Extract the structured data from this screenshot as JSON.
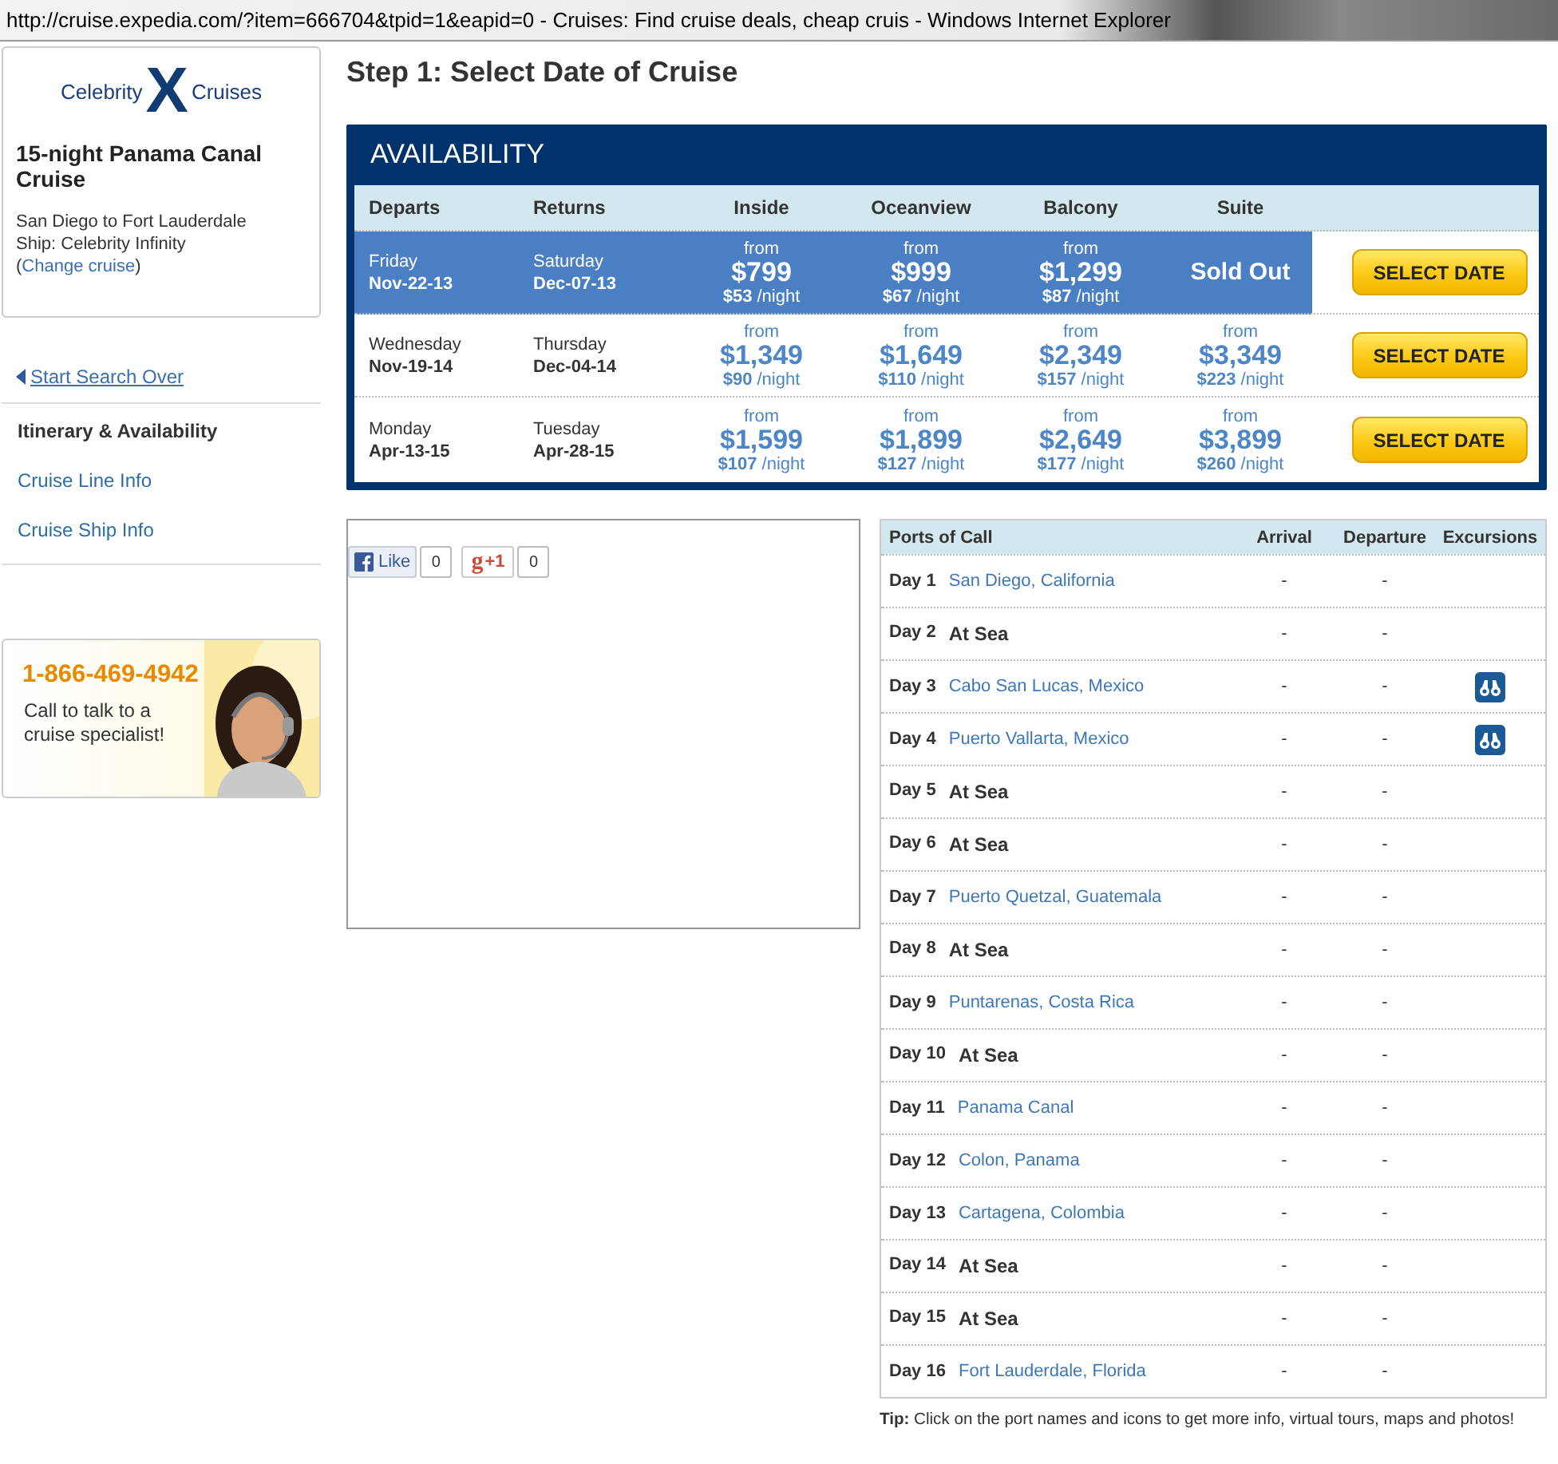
{
  "window": {
    "title": "http://cruise.expedia.com/?item=666704&tpid=1&eapid=0 - Cruises: Find cruise deals, cheap cruis - Windows Internet Explorer"
  },
  "sidebar": {
    "logo": {
      "left": "Celebrity",
      "mark": "X",
      "right": "Cruises"
    },
    "cruise_title": "15-night Panama Canal Cruise",
    "route": "San Diego to Fort Lauderdale",
    "ship": "Ship:  Celebrity Infinity",
    "change_open": "(",
    "change_link": "Change cruise",
    "change_close": ")",
    "start_over": "Start Search Over",
    "nav": [
      {
        "label": "Itinerary & Availability",
        "selected": true
      },
      {
        "label": "Cruise Line Info",
        "selected": false
      },
      {
        "label": "Cruise Ship Info",
        "selected": false
      }
    ],
    "ad": {
      "phone": "1-866-469-4942",
      "text": "Call to talk to a cruise specialist!"
    }
  },
  "heading": "Step 1: Select Date of Cruise",
  "availability": {
    "title": "AVAILABILITY",
    "columns": [
      "Departs",
      "Returns",
      "Inside",
      "Oceanview",
      "Balcony",
      "Suite"
    ],
    "rows": [
      {
        "selected": true,
        "depart_day": "Friday",
        "depart_date": "Nov-22-13",
        "return_day": "Saturday",
        "return_date": "Dec-07-13",
        "prices": [
          {
            "kind": "price",
            "from": "from",
            "price": "$799",
            "per_night": "**$53** /night"
          },
          {
            "kind": "price",
            "from": "from",
            "price": "$999",
            "per_night": "**$67** /night"
          },
          {
            "kind": "price",
            "from": "from",
            "price": "$1,299",
            "per_night": "**$87** /night"
          },
          {
            "kind": "sold_out",
            "text": "Sold Out"
          }
        ],
        "button": "SELECT DATE"
      },
      {
        "selected": false,
        "depart_day": "Wednesday",
        "depart_date": "Nov-19-14",
        "return_day": "Thursday",
        "return_date": "Dec-04-14",
        "prices": [
          {
            "kind": "price",
            "from": "from",
            "price": "$1,349",
            "per_night": "**$90** /night"
          },
          {
            "kind": "price",
            "from": "from",
            "price": "$1,649",
            "per_night": "**$110** /night"
          },
          {
            "kind": "price",
            "from": "from",
            "price": "$2,349",
            "per_night": "**$157** /night"
          },
          {
            "kind": "price",
            "from": "from",
            "price": "$3,349",
            "per_night": "**$223** /night"
          }
        ],
        "button": "SELECT DATE"
      },
      {
        "selected": false,
        "depart_day": "Monday",
        "depart_date": "Apr-13-15",
        "return_day": "Tuesday",
        "return_date": "Apr-28-15",
        "prices": [
          {
            "kind": "price",
            "from": "from",
            "price": "$1,599",
            "per_night": "**$107** /night"
          },
          {
            "kind": "price",
            "from": "from",
            "price": "$1,899",
            "per_night": "**$127** /night"
          },
          {
            "kind": "price",
            "from": "from",
            "price": "$2,649",
            "per_night": "**$177** /night"
          },
          {
            "kind": "price",
            "from": "from",
            "price": "$3,899",
            "per_night": "**$260** /night"
          }
        ],
        "button": "SELECT DATE"
      }
    ]
  },
  "social": {
    "like": {
      "label": "Like",
      "count": "0"
    },
    "plus": {
      "mark": "g",
      "label": "+1",
      "count": "0"
    }
  },
  "ports": {
    "columns": [
      "Ports of Call",
      "Arrival",
      "Departure",
      "Excursions"
    ],
    "rows": [
      {
        "day": "Day 1",
        "kind": "port",
        "name": "San Diego, California",
        "arrival": "-",
        "departure": "-",
        "excursion": false
      },
      {
        "day": "Day 2",
        "kind": "sea",
        "name": "At Sea",
        "arrival": "-",
        "departure": "-",
        "excursion": false
      },
      {
        "day": "Day 3",
        "kind": "port",
        "name": "Cabo San Lucas, Mexico",
        "arrival": "-",
        "departure": "-",
        "excursion": true
      },
      {
        "day": "Day 4",
        "kind": "port",
        "name": "Puerto Vallarta, Mexico",
        "arrival": "-",
        "departure": "-",
        "excursion": true
      },
      {
        "day": "Day 5",
        "kind": "sea",
        "name": "At Sea",
        "arrival": "-",
        "departure": "-",
        "excursion": false
      },
      {
        "day": "Day 6",
        "kind": "sea",
        "name": "At Sea",
        "arrival": "-",
        "departure": "-",
        "excursion": false
      },
      {
        "day": "Day 7",
        "kind": "port",
        "name": "Puerto Quetzal, Guatemala",
        "arrival": "-",
        "departure": "-",
        "excursion": false
      },
      {
        "day": "Day 8",
        "kind": "sea",
        "name": "At Sea",
        "arrival": "-",
        "departure": "-",
        "excursion": false
      },
      {
        "day": "Day 9",
        "kind": "port",
        "name": "Puntarenas, Costa Rica",
        "arrival": "-",
        "departure": "-",
        "excursion": false
      },
      {
        "day": "Day 10",
        "kind": "sea",
        "name": "At Sea",
        "arrival": "-",
        "departure": "-",
        "excursion": false
      },
      {
        "day": "Day 11",
        "kind": "port",
        "name": "Panama Canal",
        "arrival": "-",
        "departure": "-",
        "excursion": false
      },
      {
        "day": "Day 12",
        "kind": "port",
        "name": "Colon, Panama",
        "arrival": "-",
        "departure": "-",
        "excursion": false
      },
      {
        "day": "Day 13",
        "kind": "port",
        "name": "Cartagena, Colombia",
        "arrival": "-",
        "departure": "-",
        "excursion": false
      },
      {
        "day": "Day 14",
        "kind": "sea",
        "name": "At Sea",
        "arrival": "-",
        "departure": "-",
        "excursion": false
      },
      {
        "day": "Day 15",
        "kind": "sea",
        "name": "At Sea",
        "arrival": "-",
        "departure": "-",
        "excursion": false
      },
      {
        "day": "Day 16",
        "kind": "port",
        "name": "Fort Lauderdale, Florida",
        "arrival": "-",
        "departure": "-",
        "excursion": false
      }
    ],
    "tip": "**Tip:** Click on the port names and icons to get more info, virtual tours, maps and photos!"
  }
}
